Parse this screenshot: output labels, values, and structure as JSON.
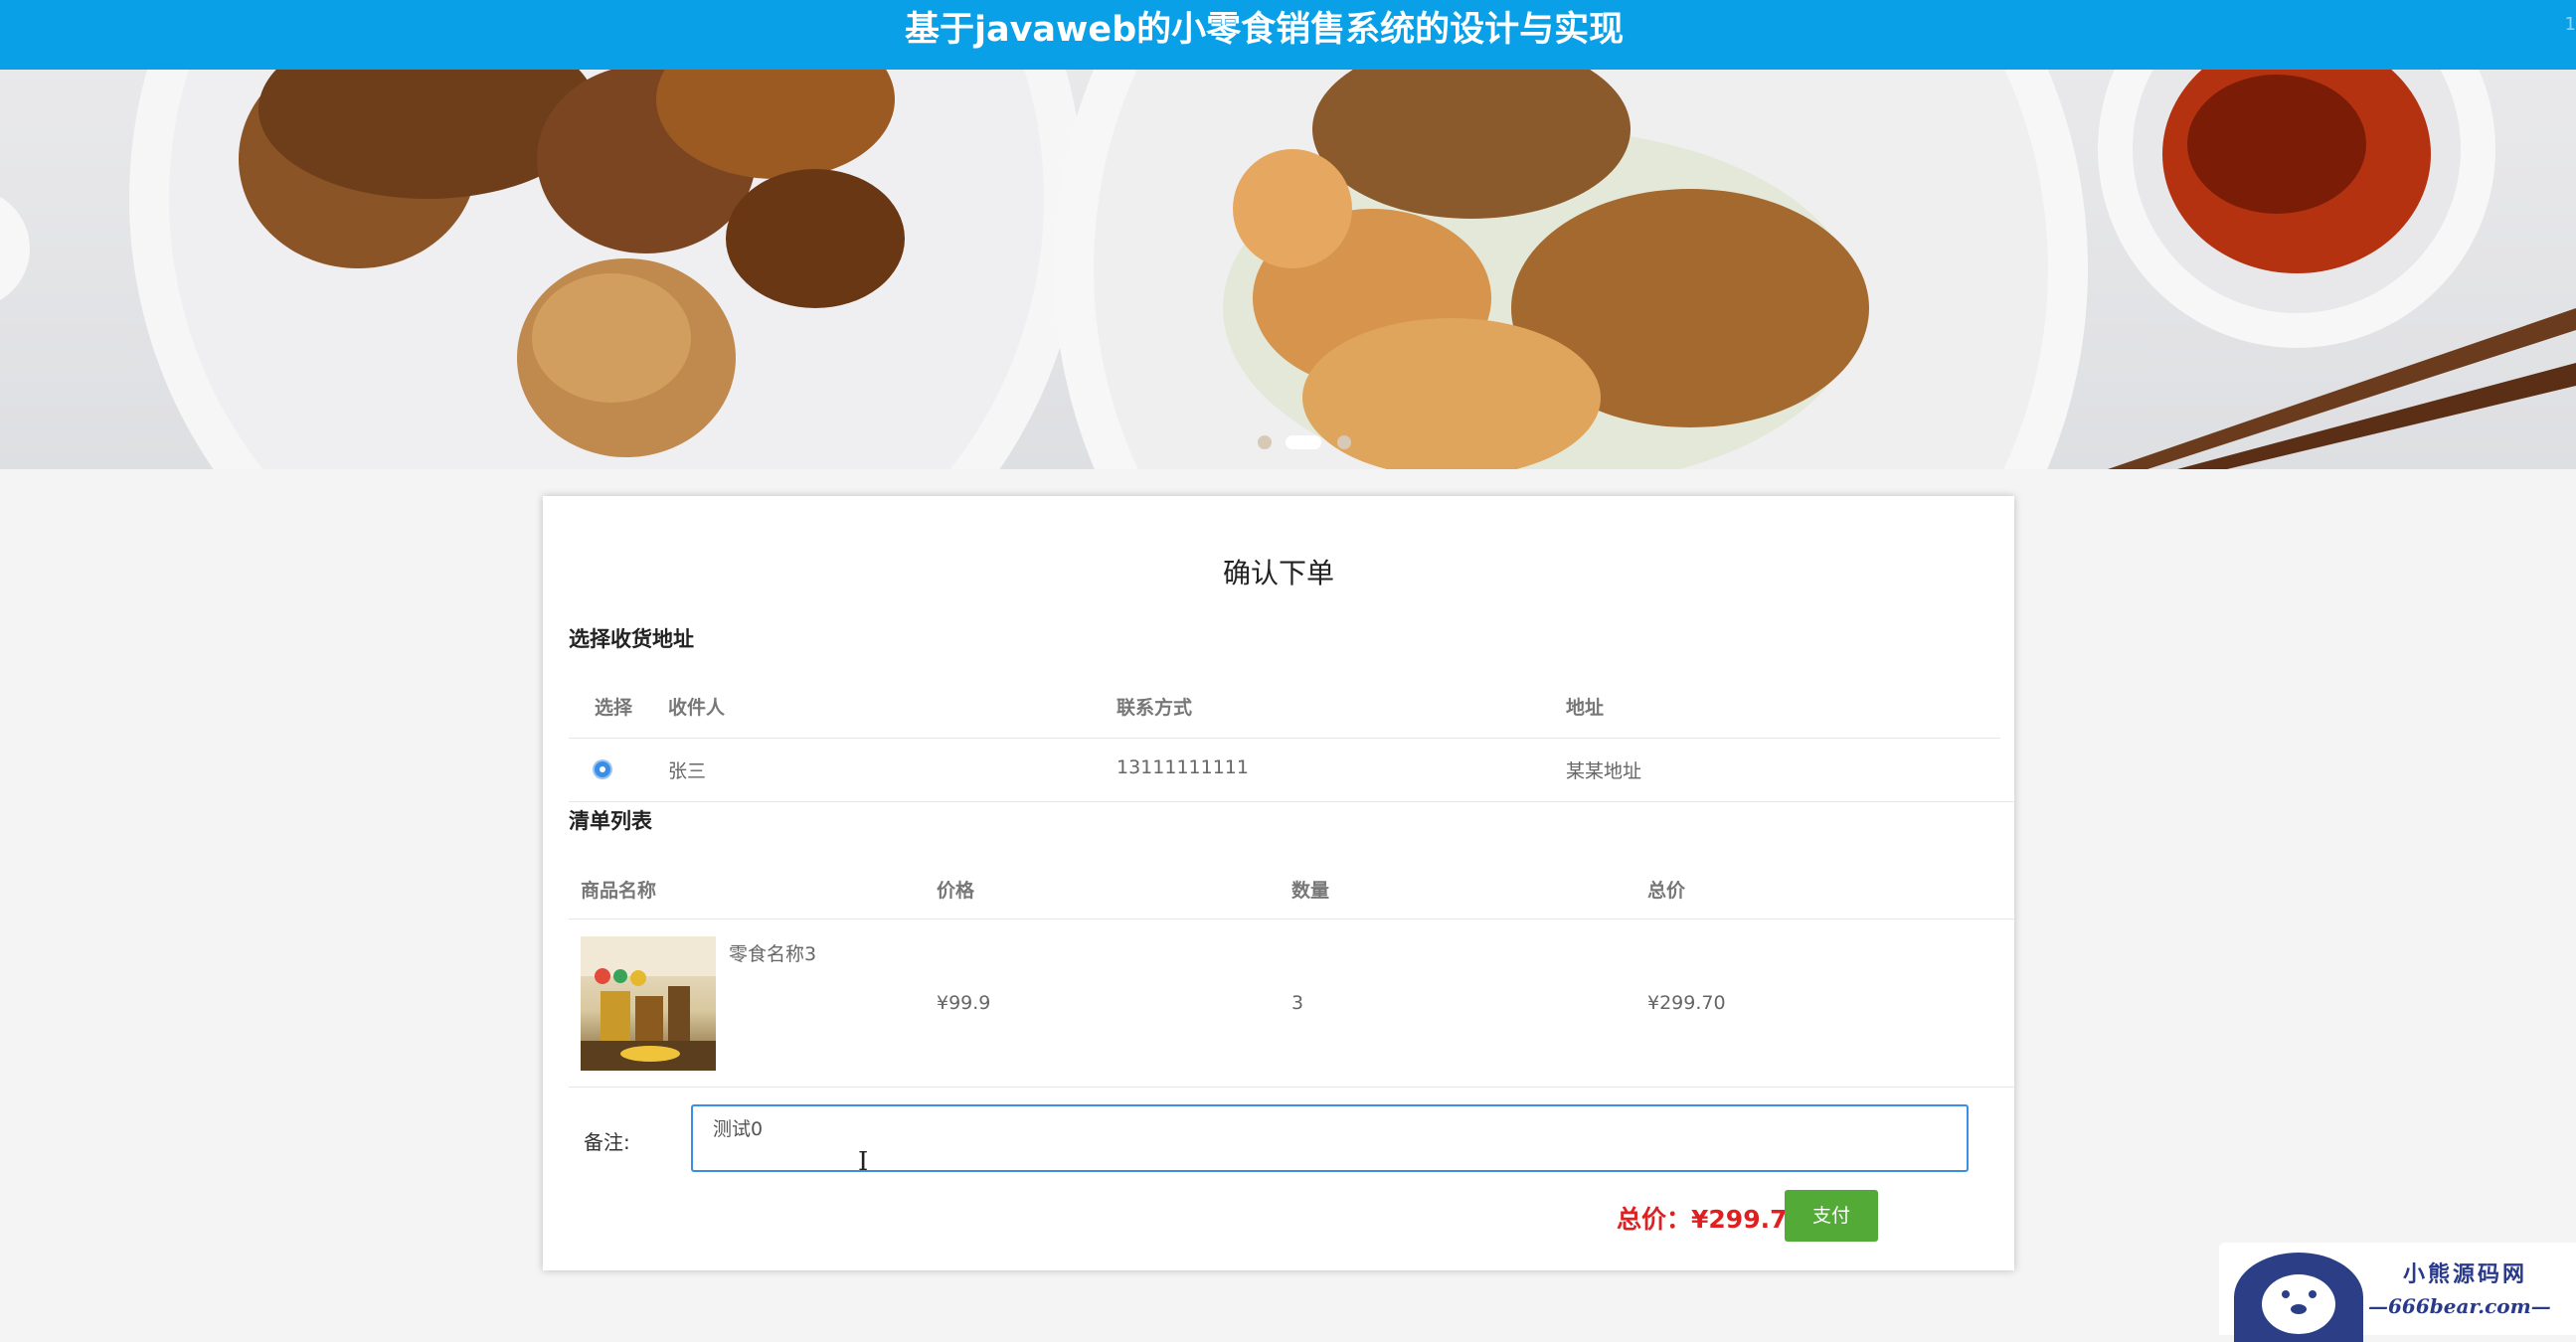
{
  "header": {
    "title": "基于javaweb的小零食销售系统的设计与实现",
    "corner_text": "1"
  },
  "order": {
    "title": "确认下单",
    "address_section": "选择收货地址",
    "address_headers": {
      "select": "选择",
      "receiver": "收件人",
      "contact": "联系方式",
      "address": "地址"
    },
    "address_rows": [
      {
        "selected": true,
        "receiver": "张三",
        "contact": "13111111111",
        "address": "某某地址"
      }
    ],
    "items_section": "清单列表",
    "item_headers": {
      "name": "商品名称",
      "price": "价格",
      "qty": "数量",
      "total": "总价"
    },
    "items": [
      {
        "name": "零食名称3",
        "price": "¥99.9",
        "qty": "3",
        "total": "¥299.70"
      }
    ],
    "remark_label": "备注:",
    "remark_value": "测试0",
    "total_label": "总价：",
    "total_value": "¥299.70",
    "pay_label": "支付"
  },
  "watermark": {
    "line1": "小熊源码网",
    "line2": "—666bear.com—"
  },
  "colors": {
    "header": "#0aa0e8",
    "accent": "#3a8ee6",
    "total": "#e02020",
    "pay": "#53aa36"
  }
}
